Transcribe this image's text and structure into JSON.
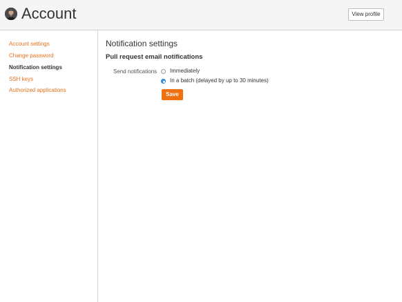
{
  "header": {
    "title": "Account",
    "view_profile_label": "View profile",
    "avatar_icon": "user-avatar"
  },
  "sidebar": {
    "items": [
      {
        "label": "Account settings",
        "active": false
      },
      {
        "label": "Change password",
        "active": false
      },
      {
        "label": "Notification settings",
        "active": true
      },
      {
        "label": "SSH keys",
        "active": false
      },
      {
        "label": "Authorized applications",
        "active": false
      }
    ]
  },
  "main": {
    "heading": "Notification settings",
    "section_heading": "Pull request email notifications",
    "field_label": "Send notifications",
    "options": [
      {
        "label": "Immediately",
        "checked": false
      },
      {
        "label": "In a batch (delayed by up to 30 minutes)",
        "checked": true
      }
    ],
    "save_label": "Save"
  },
  "colors": {
    "accent": "#e8711d",
    "save_button": "#f0700f",
    "radio_selected": "#3a8ee6",
    "header_bg": "#f5f5f5"
  }
}
